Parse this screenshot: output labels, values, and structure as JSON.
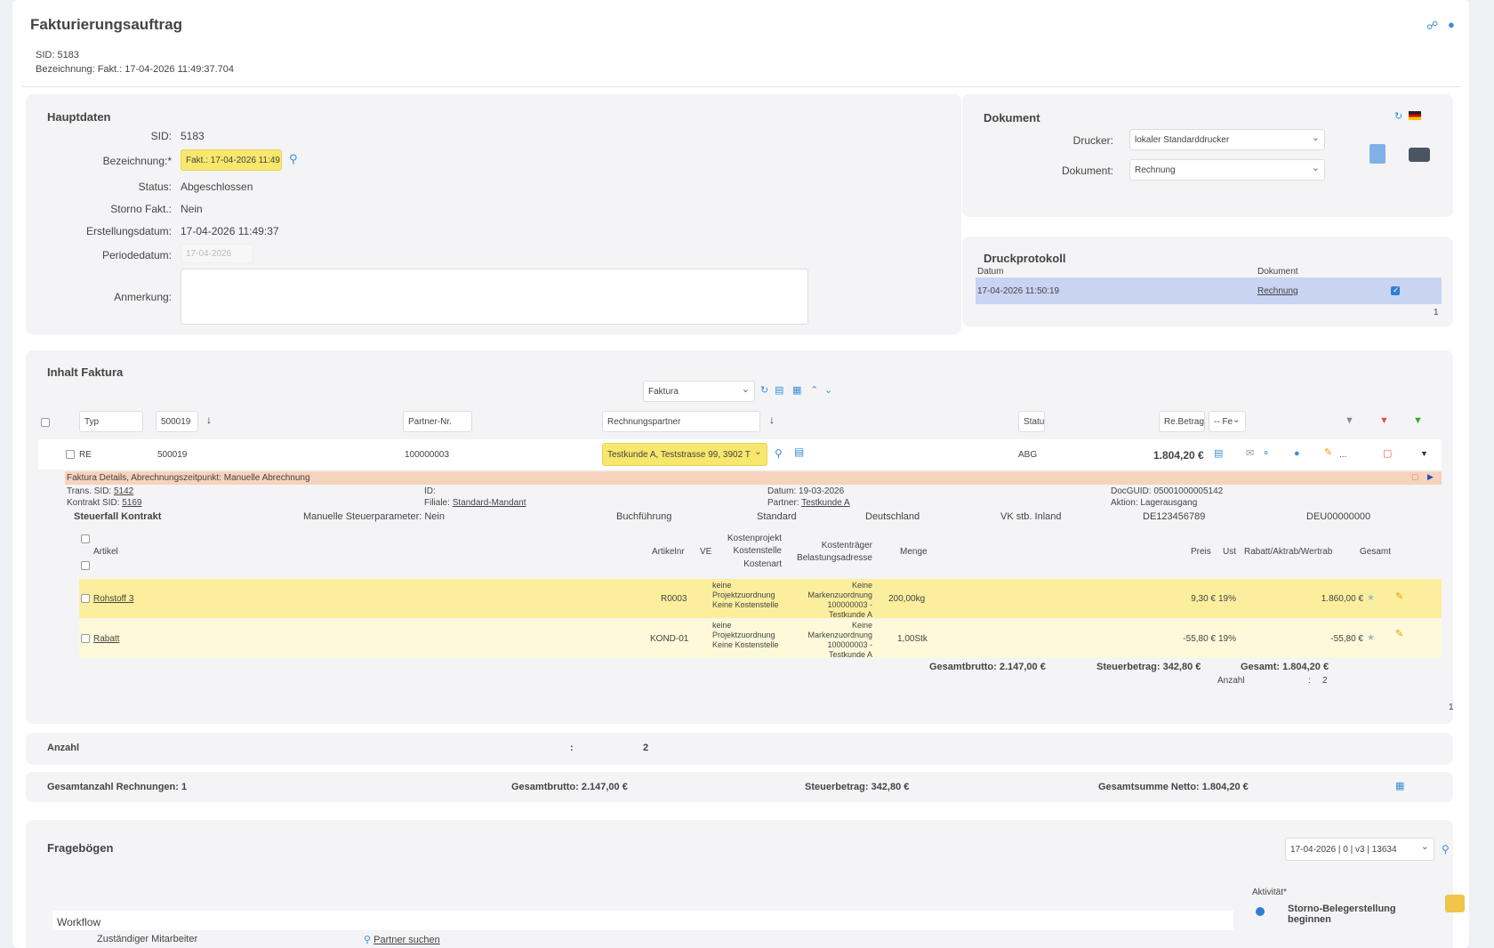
{
  "header": {
    "title": "Fakturierungsauftrag",
    "sid_line": "SID: 5183",
    "bez_line": "Bezeichnung: Fakt.: 17-04-2026 11:49:37.704"
  },
  "hauptdaten": {
    "title": "Hauptdaten",
    "sid_label": "SID:",
    "sid_value": "5183",
    "bez_label": "Bezeichnung:*",
    "bez_value": "Fakt.: 17-04-2026 11:49",
    "status_label": "Status:",
    "status_value": "Abgeschlossen",
    "storno_label": "Storno Fakt.:",
    "storno_value": "Nein",
    "erst_label": "Erstellungsdatum:",
    "erst_value": "17-04-2026 11:49:37",
    "periode_label": "Periodedatum:",
    "periode_placeholder": "17-04-2026",
    "anm_label": "Anmerkung:"
  },
  "dokument": {
    "title": "Dokument",
    "drucker_label": "Drucker:",
    "drucker_value": "lokaler Standarddrucker",
    "dok_label": "Dokument:",
    "dok_value": "Rechnung"
  },
  "druckprotokoll": {
    "title": "Druckprotokoll",
    "col_datum": "Datum",
    "col_dokument": "Dokument",
    "row_datum": "17-04-2026 11:50:19",
    "row_dokument": "Rechnung",
    "count": "1"
  },
  "inhalt": {
    "title": "Inhalt Faktura",
    "view_select": "Faktura",
    "filters": {
      "typ": "Typ",
      "nr": "500019",
      "partner_nr": "Partner-Nr.",
      "rechnungspartner": "Rechnungspartner",
      "status": "Statu",
      "rebetrag": "Re.Betrag",
      "fe": "-- Fe"
    },
    "row": {
      "typ": "RE",
      "nr": "500019",
      "partner_nr": "100000003",
      "partner": "Testkunde A, Teststrasse 99, 3902 T",
      "status": "ABG",
      "betrag": "1.804,20 €",
      "more": "..."
    },
    "details": {
      "banner": "Faktura Details, Abrechnungszeitpunkt: Manuelle Abrechnung",
      "trans_label": "Trans. SID:",
      "trans_value": "5142",
      "kontrakt_label": "Kontrakt SID:",
      "kontrakt_value": "5169",
      "id_label": "ID:",
      "filiale_label": "Filiale:",
      "filiale_value": "Standard-Mandant",
      "datum_label": "Datum: 19-03-2026",
      "partner_label": "Partner:",
      "partner_value": "Testkunde A",
      "docguid": "DocGUID: 05001000005142",
      "aktion": "Aktion: Lagerausgang",
      "steuerfall": "Steuerfall Kontrakt",
      "manuelle": "Manuelle Steuerparameter: Nein",
      "buchfuehrung": "Buchführung",
      "standard": "Standard",
      "land": "Deutschland",
      "vk": "VK stb. Inland",
      "ust_id": "DE123456789",
      "deu": "DEU00000000"
    },
    "columns": {
      "artikel": "Artikel",
      "artikelnr": "Artikelnr",
      "ve": "VE",
      "kostenprojekt": "Kostenprojekt",
      "kostenstelle": "Kostenstelle",
      "kostenart": "Kostenart",
      "kostentraeger": "Kostenträger",
      "belastung": "Belastungsadresse",
      "menge": "Menge",
      "preis": "Preis",
      "ust": "Ust",
      "rabatt": "Rabatt/Aktrab/Wertrab",
      "gesamt": "Gesamt"
    },
    "items": [
      {
        "artikel": "Rohstoff 3",
        "artikelnr": "R0003",
        "kosten1": "keine",
        "kosten2": "Projektzuordnung",
        "kosten3": "Keine Kostenstelle",
        "kt1": "Keine",
        "kt2": "Markenzuordnung",
        "kt3": "100000003 -",
        "kt4": "Testkunde A",
        "menge": "200,00kg",
        "preis": "9,30 €",
        "ust": "19%",
        "gesamt": "1.860,00 €"
      },
      {
        "artikel": "Rabatt",
        "artikelnr": "KOND-01",
        "kosten1": "keine",
        "kosten2": "Projektzuordnung",
        "kosten3": "Keine Kostenstelle",
        "kt1": "Keine",
        "kt2": "Markenzuordnung",
        "kt3": "100000003 -",
        "kt4": "Testkunde A",
        "menge": "1,00Stk",
        "preis": "-55,80 €",
        "ust": "19%",
        "gesamt": "-55,80 €"
      }
    ],
    "totals": {
      "brutto": "Gesamtbrutto: 2.147,00 €",
      "steuer": "Steuerbetrag: 342,80 €",
      "gesamt": "Gesamt: 1.804,20 €",
      "anzahl_label": "Anzahl",
      "anzahl_colon": ":",
      "anzahl_value": "2"
    },
    "page": "1"
  },
  "anzahl_bar": {
    "label": "Anzahl",
    "colon": ":",
    "value": "2"
  },
  "summary_bar": {
    "rechnungen": "Gesamtanzahl Rechnungen: 1",
    "brutto": "Gesamtbrutto: 2.147,00 €",
    "steuer": "Steuerbetrag: 342,80 €",
    "netto": "Gesamtsumme Netto: 1.804,20 €"
  },
  "frageboegen": {
    "title": "Fragebögen",
    "version_select": "17-04-2026 | 0 | v3 | 13634",
    "aktivitaet_label": "Aktivität*",
    "aktivitaet_option_line1": "Storno-Belegerstellung",
    "aktivitaet_option_line2": "beginnen",
    "workflow": "Workflow",
    "mitarbeiter": "Zuständiger Mitarbeiter",
    "partner_suchen": "Partner suchen"
  },
  "colors": {
    "accent": "#3a8fd8",
    "highlight_yellow": "#f7e76c",
    "row_yellow": "#fbef9e",
    "row_light_yellow": "#fdf9d9",
    "banner_orange": "#f6d3bc",
    "selected_row": "#c9d3f2"
  }
}
